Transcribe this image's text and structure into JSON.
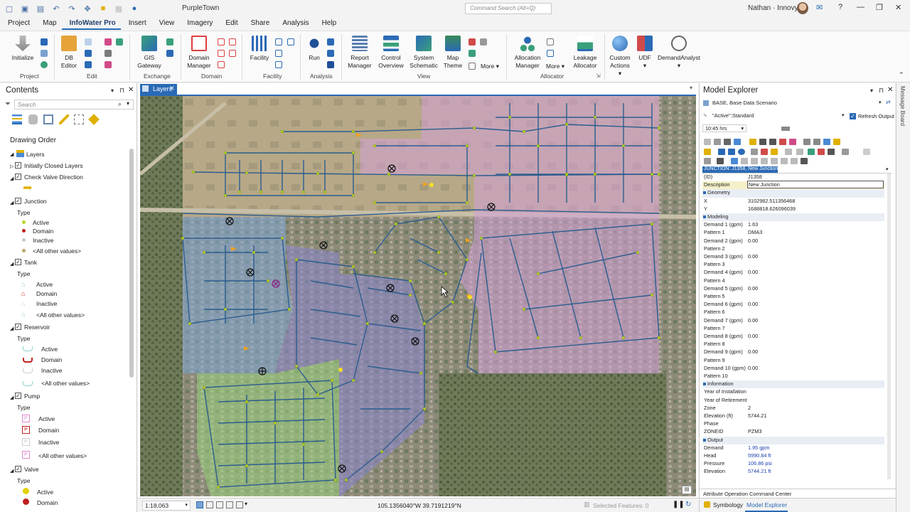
{
  "app": {
    "title": "PurpleTown",
    "command_search_placeholder": "Command Search (Alt+Q)",
    "user_name": "Nathan · Innovyze"
  },
  "menu": [
    "Project",
    "Map",
    "InfoWater Pro",
    "Insert",
    "View",
    "Imagery",
    "Edit",
    "Share",
    "Analysis",
    "Help"
  ],
  "ribbon": {
    "buttons": {
      "initialize": "Initialize",
      "db_editor": "DB Editor",
      "gis_gateway": "GIS Gateway",
      "domain_manager": "Domain Manager",
      "facility": "Facility",
      "run": "Run",
      "report_manager": "Report Manager",
      "control_overview": "Control Overview",
      "system_schematic": "System Schematic",
      "map_theme": "Map Theme",
      "more": "More",
      "allocation_manager": "Allocation Manager",
      "more2": "More",
      "leakage_allocator": "Leakage Allocator",
      "custom_actions": "Custom Actions",
      "udf": "UDF",
      "demand_analyst": "DemandAnalyst"
    },
    "groups": {
      "project": "Project",
      "edit": "Edit",
      "exchange": "Exchange",
      "domain": "Domain",
      "facility": "Facility",
      "analysis": "Analysis",
      "view": "View",
      "allocator": "Allocator"
    }
  },
  "contents": {
    "title": "Contents",
    "search_placeholder": "Search",
    "drawing_order": "Drawing Order",
    "layers_root": "Layers",
    "layers": {
      "initially_closed": "Initially Closed Layers",
      "check_valve": "Check Valve Direction",
      "junction": "Junction",
      "tank": "Tank",
      "reservoir": "Reservoir",
      "pump": "Pump",
      "valve": "Valve"
    },
    "type_label": "Type",
    "values": {
      "active": "Active",
      "domain": "Domain",
      "inactive": "Inactive",
      "other": "<All other values>"
    }
  },
  "map": {
    "tab": "Layers",
    "scale": "1:18,063",
    "coordinates": "105.1356040°W 39.7191219°N",
    "selected_features": "Selected Features: 0"
  },
  "explorer": {
    "title": "Model Explorer",
    "scenario": "BASE, Base Data Scenario",
    "query": "\"Active\":Standard",
    "refresh_output": "Refresh Output",
    "time": "10:45 hrs",
    "header": "JUNCTION: J1358, New Junction",
    "tabs": {
      "attribute": "Attribute",
      "operation": "Operation",
      "command_center": "Command Center",
      "symbology": "Symbology",
      "model_explorer": "Model Explorer"
    },
    "rows": [
      {
        "k": "(ID)",
        "v": "J1358",
        "t": "id"
      },
      {
        "k": "Description",
        "v": "New Junction",
        "t": "desc"
      },
      {
        "k": "Geometry",
        "v": "",
        "t": "sec"
      },
      {
        "k": "X",
        "v": "3102982.511356468",
        "t": ""
      },
      {
        "k": "Y",
        "v": "1688818.626096039",
        "t": ""
      },
      {
        "k": "Modeling",
        "v": "",
        "t": "sec"
      },
      {
        "k": "Demand 1 (gpm)",
        "v": "1.63",
        "t": ""
      },
      {
        "k": "Pattern 1",
        "v": "DMA3",
        "t": ""
      },
      {
        "k": "Demand 2 (gpm)",
        "v": "0.00",
        "t": ""
      },
      {
        "k": "Pattern 2",
        "v": "",
        "t": ""
      },
      {
        "k": "Demand 3 (gpm)",
        "v": "0.00",
        "t": ""
      },
      {
        "k": "Pattern 3",
        "v": "",
        "t": ""
      },
      {
        "k": "Demand 4 (gpm)",
        "v": "0.00",
        "t": ""
      },
      {
        "k": "Pattern 4",
        "v": "",
        "t": ""
      },
      {
        "k": "Demand 5 (gpm)",
        "v": "0.00",
        "t": ""
      },
      {
        "k": "Pattern 5",
        "v": "",
        "t": ""
      },
      {
        "k": "Demand 6 (gpm)",
        "v": "0.00",
        "t": ""
      },
      {
        "k": "Pattern 6",
        "v": "",
        "t": ""
      },
      {
        "k": "Demand 7 (gpm)",
        "v": "0.00",
        "t": ""
      },
      {
        "k": "Pattern 7",
        "v": "",
        "t": ""
      },
      {
        "k": "Demand 8 (gpm)",
        "v": "0.00",
        "t": ""
      },
      {
        "k": "Pattern 8",
        "v": "",
        "t": ""
      },
      {
        "k": "Demand 9 (gpm)",
        "v": "0.00",
        "t": ""
      },
      {
        "k": "Pattern 9",
        "v": "",
        "t": ""
      },
      {
        "k": "Demand 10 (gpm)",
        "v": "0.00",
        "t": ""
      },
      {
        "k": "Pattern 10",
        "v": "",
        "t": ""
      },
      {
        "k": "Information",
        "v": "",
        "t": "sec"
      },
      {
        "k": "Year of Installation",
        "v": "",
        "t": ""
      },
      {
        "k": "Year of Retirement",
        "v": "",
        "t": ""
      },
      {
        "k": "Zone",
        "v": "2",
        "t": ""
      },
      {
        "k": "Elevation (ft)",
        "v": "5744.21",
        "t": ""
      },
      {
        "k": "Phase",
        "v": "",
        "t": ""
      },
      {
        "k": "ZONEID",
        "v": "PZM3",
        "t": ""
      },
      {
        "k": "Output",
        "v": "",
        "t": "sec"
      },
      {
        "k": "Demand",
        "v": "1.95 gpm",
        "t": "blue"
      },
      {
        "k": "Head",
        "v": "5990.84 ft",
        "t": "blue"
      },
      {
        "k": "Pressure",
        "v": "106.86 psi",
        "t": "blue"
      },
      {
        "k": "Elevation",
        "v": "5744.21 ft",
        "t": "blue"
      }
    ]
  },
  "message_board": "Message Board",
  "colors": {
    "accent": "#2a6ab5",
    "zone_pink": "#d4a0d8",
    "zone_blue": "#7fa7d6",
    "zone_purple": "#8a86c6",
    "zone_green": "#9ad47e",
    "junction": "#b8d42a",
    "pipe": "#2b5d8f"
  }
}
